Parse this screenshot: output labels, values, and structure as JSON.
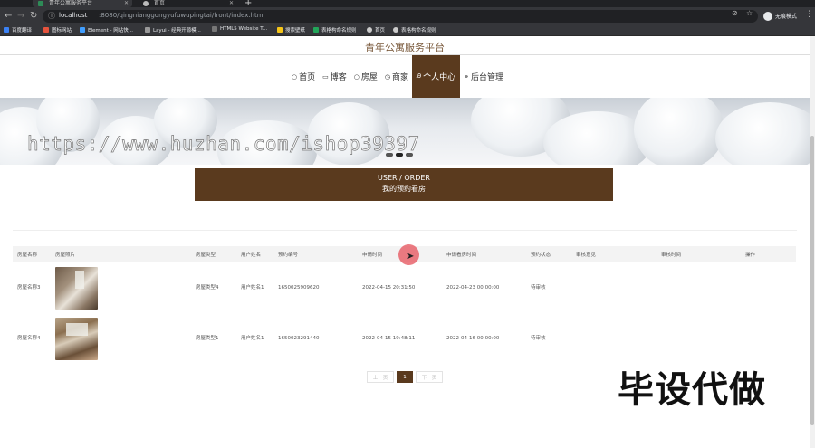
{
  "browser": {
    "tabs": [
      {
        "title": "青年公寓服务平台",
        "active": true
      },
      {
        "title": "首页",
        "active": false
      }
    ],
    "url_host": "localhost",
    "url_path": ":8080/qingnianggongyufuwupingtai/front/index.html",
    "profile_name": "无痕模式",
    "bookmarks": [
      "百度翻译",
      "图标网站",
      "Element - 网站快...",
      "Layui - 经典开源模...",
      "HTML5 Website T...",
      "搜索壁纸",
      "表格构命名规则",
      "首页",
      "表格构命名规则"
    ]
  },
  "site": {
    "title": "青年公寓服务平台",
    "nav": [
      {
        "icon": "○",
        "label": "首页"
      },
      {
        "icon": "▭",
        "label": "博客"
      },
      {
        "icon": "○",
        "label": "房屋"
      },
      {
        "icon": "◷",
        "label": "商家"
      },
      {
        "icon": "Ꭿ",
        "label": "个人中心",
        "active": true
      },
      {
        "icon": "⚭",
        "label": "后台管理"
      }
    ],
    "watermark": "https://www.huzhan.com/ishop39397"
  },
  "section": {
    "en": "USER / ORDER",
    "cn": "我的预约看房"
  },
  "table": {
    "headers": [
      "房屋名称",
      "房屋照片",
      "房屋类型",
      "用户姓名",
      "预约编号",
      "申请时间",
      "申请看房时间",
      "预约状态",
      "审核意见",
      "审核时间",
      "操作"
    ],
    "rows": [
      {
        "name": "房屋名称3",
        "type": "房屋类型4",
        "user": "用户姓名1",
        "order_no": "1650025909620",
        "apply_time": "2022-04-15 20:31:50",
        "view_time": "2022-04-23 00:00:00",
        "status": "待审核",
        "opinion": "",
        "review_time": "",
        "action": ""
      },
      {
        "name": "房屋名称4",
        "type": "房屋类型1",
        "user": "用户姓名1",
        "order_no": "1650023291440",
        "apply_time": "2022-04-15 19:48:11",
        "view_time": "2022-04-16 00:00:00",
        "status": "待审核",
        "opinion": "",
        "review_time": "",
        "action": ""
      }
    ]
  },
  "pagination": {
    "prev": "上一页",
    "current": "1",
    "next": "下一页"
  },
  "overlay_text": "毕设代做"
}
